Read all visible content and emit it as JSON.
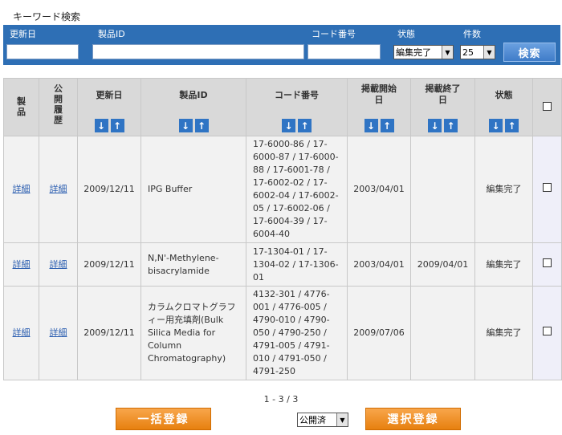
{
  "search": {
    "title": "キーワード検索",
    "labels": {
      "updated": "更新日",
      "product_id": "製品ID",
      "code": "コード番号",
      "status": "状態",
      "count": "件数"
    },
    "status_selected": "編集完了",
    "count_selected": "25",
    "search_button": "検索"
  },
  "table": {
    "headers": {
      "product": "製品",
      "history": "公開履歴",
      "updated": "更新日",
      "product_id": "製品ID",
      "code": "コード番号",
      "pub_start": "掲載開始日",
      "pub_end": "掲載終了日",
      "status": "状態"
    },
    "sort_down": "↓",
    "sort_up": "↑",
    "rows": [
      {
        "product": "詳細",
        "history": "詳細",
        "updated": "2009/12/11",
        "product_id": "IPG Buffer",
        "code": "17-6000-86 / 17-6000-87 / 17-6000-88 / 17-6001-78 / 17-6002-02 / 17-6002-04 / 17-6002-05 / 17-6002-06 / 17-6004-39 / 17-6004-40",
        "pub_start": "2003/04/01",
        "pub_end": "",
        "status": "編集完了"
      },
      {
        "product": "詳細",
        "history": "詳細",
        "updated": "2009/12/11",
        "product_id": "N,N'-Methylene-bisacrylamide",
        "code": "17-1304-01 / 17-1304-02 / 17-1306-01",
        "pub_start": "2003/04/01",
        "pub_end": "2009/04/01",
        "status": "編集完了"
      },
      {
        "product": "詳細",
        "history": "詳細",
        "updated": "2009/12/11",
        "product_id": "カラムクロマトグラフィー用充填剤(Bulk Silica Media for Column Chromatography)",
        "code": "4132-301 / 4776-001 / 4776-005 / 4790-010 / 4790-050 / 4790-250 / 4791-005 / 4791-010 / 4791-050 / 4791-250",
        "pub_start": "2009/07/06",
        "pub_end": "",
        "status": "編集完了"
      }
    ]
  },
  "footer": {
    "pager": "1 - 3 / 3",
    "bulk_register": "一括登録",
    "publish_selected": "公開済",
    "select_register": "選択登録"
  }
}
